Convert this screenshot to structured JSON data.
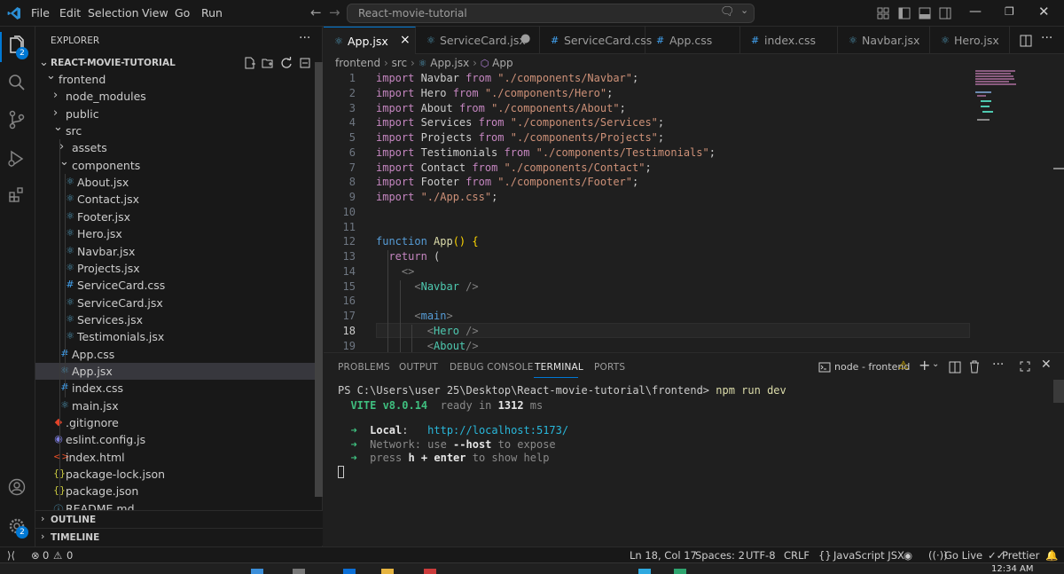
{
  "menu": [
    "File",
    "Edit",
    "Selection",
    "View",
    "Go",
    "Run"
  ],
  "command_center": {
    "text": "React-movie-tutorial"
  },
  "activity": {
    "badge_scm": "2",
    "badge_settings": "2"
  },
  "explorer": {
    "title": "EXPLORER",
    "root": "REACT-MOVIE-TUTORIAL",
    "items": [
      {
        "label": "frontend",
        "kind": "folder-open",
        "depth": 0
      },
      {
        "label": "node_modules",
        "kind": "folder",
        "depth": 1
      },
      {
        "label": "public",
        "kind": "folder",
        "depth": 1
      },
      {
        "label": "src",
        "kind": "folder-open",
        "depth": 1
      },
      {
        "label": "assets",
        "kind": "folder",
        "depth": 2
      },
      {
        "label": "components",
        "kind": "folder-open",
        "depth": 2
      },
      {
        "label": "About.jsx",
        "kind": "react",
        "depth": 3
      },
      {
        "label": "Contact.jsx",
        "kind": "react",
        "depth": 3
      },
      {
        "label": "Footer.jsx",
        "kind": "react",
        "depth": 3
      },
      {
        "label": "Hero.jsx",
        "kind": "react",
        "depth": 3
      },
      {
        "label": "Navbar.jsx",
        "kind": "react",
        "depth": 3
      },
      {
        "label": "Projects.jsx",
        "kind": "react",
        "depth": 3
      },
      {
        "label": "ServiceCard.css",
        "kind": "css",
        "depth": 3
      },
      {
        "label": "ServiceCard.jsx",
        "kind": "react",
        "depth": 3
      },
      {
        "label": "Services.jsx",
        "kind": "react",
        "depth": 3
      },
      {
        "label": "Testimonials.jsx",
        "kind": "react",
        "depth": 3
      },
      {
        "label": "App.css",
        "kind": "css",
        "depth": 2
      },
      {
        "label": "App.jsx",
        "kind": "react",
        "depth": 2
      },
      {
        "label": "index.css",
        "kind": "css",
        "depth": 2
      },
      {
        "label": "main.jsx",
        "kind": "react",
        "depth": 2
      },
      {
        "label": ".gitignore",
        "kind": "git",
        "depth": 1
      },
      {
        "label": "eslint.config.js",
        "kind": "eslint",
        "depth": 1
      },
      {
        "label": "index.html",
        "kind": "html",
        "depth": 1
      },
      {
        "label": "package-lock.json",
        "kind": "json",
        "depth": 1
      },
      {
        "label": "package.json",
        "kind": "json",
        "depth": 1
      },
      {
        "label": "README.md",
        "kind": "info",
        "depth": 1
      }
    ],
    "outline": "OUTLINE",
    "timeline": "TIMELINE"
  },
  "tabs": [
    {
      "label": "App.jsx",
      "kind": "react",
      "active": true,
      "close": "×"
    },
    {
      "label": "ServiceCard.jsx",
      "kind": "react",
      "dirty": true
    },
    {
      "label": "ServiceCard.css",
      "kind": "css"
    },
    {
      "label": "App.css",
      "kind": "css"
    },
    {
      "label": "index.css",
      "kind": "css"
    },
    {
      "label": "Navbar.jsx",
      "kind": "react"
    },
    {
      "label": "Hero.jsx",
      "kind": "react"
    }
  ],
  "breadcrumb": [
    "frontend",
    "src",
    "App.jsx",
    "App"
  ],
  "code_lines": [
    [
      [
        "kw",
        "import"
      ],
      [
        "id",
        " Navbar "
      ],
      [
        "kw",
        "from"
      ],
      [
        "st",
        " \"./components/Navbar\""
      ],
      [
        "id",
        ";"
      ]
    ],
    [
      [
        "kw",
        "import"
      ],
      [
        "id",
        " Hero "
      ],
      [
        "kw",
        "from"
      ],
      [
        "st",
        " \"./components/Hero\""
      ],
      [
        "id",
        ";"
      ]
    ],
    [
      [
        "kw",
        "import"
      ],
      [
        "id",
        " About "
      ],
      [
        "kw",
        "from"
      ],
      [
        "st",
        " \"./components/About\""
      ],
      [
        "id",
        ";"
      ]
    ],
    [
      [
        "kw",
        "import"
      ],
      [
        "id",
        " Services "
      ],
      [
        "kw",
        "from"
      ],
      [
        "st",
        " \"./components/Services\""
      ],
      [
        "id",
        ";"
      ]
    ],
    [
      [
        "kw",
        "import"
      ],
      [
        "id",
        " Projects "
      ],
      [
        "kw",
        "from"
      ],
      [
        "st",
        " \"./components/Projects\""
      ],
      [
        "id",
        ";"
      ]
    ],
    [
      [
        "kw",
        "import"
      ],
      [
        "id",
        " Testimonials "
      ],
      [
        "kw",
        "from"
      ],
      [
        "st",
        " \"./components/Testimonials\""
      ],
      [
        "id",
        ";"
      ]
    ],
    [
      [
        "kw",
        "import"
      ],
      [
        "id",
        " Contact "
      ],
      [
        "kw",
        "from"
      ],
      [
        "st",
        " \"./components/Contact\""
      ],
      [
        "id",
        ";"
      ]
    ],
    [
      [
        "kw",
        "import"
      ],
      [
        "id",
        " Footer "
      ],
      [
        "kw",
        "from"
      ],
      [
        "st",
        " \"./components/Footer\""
      ],
      [
        "id",
        ";"
      ]
    ],
    [
      [
        "kw",
        "import"
      ],
      [
        "st",
        " \"./App.css\""
      ],
      [
        "id",
        ";"
      ]
    ],
    [],
    [],
    [
      [
        "tg",
        "function"
      ],
      [
        "fn",
        " App"
      ],
      [
        "br",
        "()"
      ],
      [
        "id",
        " "
      ],
      [
        "br",
        "{"
      ]
    ],
    [
      [
        "id",
        "  "
      ],
      [
        "kw",
        "return"
      ],
      [
        "id",
        " ("
      ]
    ],
    [
      [
        "id",
        "    "
      ],
      [
        "pn",
        "<>"
      ]
    ],
    [
      [
        "id",
        "      "
      ],
      [
        "pn",
        "<"
      ],
      [
        "jsx",
        "Navbar"
      ],
      [
        "pn",
        " />"
      ]
    ],
    [],
    [
      [
        "id",
        "      "
      ],
      [
        "pn",
        "<"
      ],
      [
        "tg",
        "main"
      ],
      [
        "pn",
        ">"
      ]
    ],
    [
      [
        "id",
        "        "
      ],
      [
        "pn",
        "<"
      ],
      [
        "jsx",
        "Hero"
      ],
      [
        "pn",
        " />"
      ]
    ],
    [
      [
        "id",
        "        "
      ],
      [
        "pn",
        "<"
      ],
      [
        "jsx",
        "About"
      ],
      [
        "pn",
        "/>"
      ]
    ]
  ],
  "panel": {
    "tabs": [
      "PROBLEMS",
      "OUTPUT",
      "DEBUG CONSOLE",
      "TERMINAL",
      "PORTS"
    ],
    "active": "TERMINAL",
    "terminal_name": "node - frontend",
    "terminal_lines": [
      [
        [
          "ps",
          "PS C:\\Users\\user 25\\Desktop\\React-movie-tutorial\\frontend> "
        ],
        [
          "cmd",
          "npm run dev"
        ]
      ],
      [],
      [
        [
          "vite",
          "  VITE v8.0.14"
        ],
        [
          "dim",
          "  ready in "
        ],
        [
          "bold",
          "1312"
        ],
        [
          "dim",
          " ms"
        ]
      ],
      [],
      [
        [
          "green",
          "  ➜  "
        ],
        [
          "bold",
          "Local"
        ],
        [
          "txt",
          ":   "
        ],
        [
          "cyan",
          "http://localhost:5173/"
        ]
      ],
      [
        [
          "green",
          "  ➜  "
        ],
        [
          "dim",
          "Network: use "
        ],
        [
          "bold",
          "--host"
        ],
        [
          "dim",
          " to expose"
        ]
      ],
      [
        [
          "green",
          "  ➜  "
        ],
        [
          "dim",
          "press "
        ],
        [
          "bold",
          "h + enter"
        ],
        [
          "dim",
          " to show help"
        ]
      ]
    ]
  },
  "status": {
    "errors": "0",
    "warnings": "0",
    "position": "Ln 18, Col 17",
    "spaces": "Spaces: 2",
    "encoding": "UTF-8",
    "eol": "CRLF",
    "language": "JavaScript JSX",
    "golive": "Go Live",
    "prettier": "Prettier"
  },
  "taskbar": {
    "time": "12:34 AM"
  },
  "colors": {
    "accent": "#0078d4",
    "react": "#519aba",
    "css": "#42a5f5",
    "keyword": "#c586c0",
    "string": "#ce9178",
    "warning": "#cca700"
  }
}
